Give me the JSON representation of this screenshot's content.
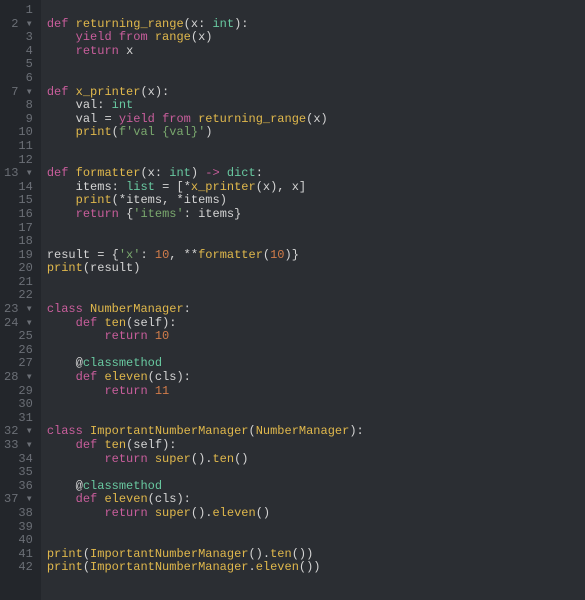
{
  "code": {
    "lines": [
      {
        "n": 1,
        "fold": false,
        "tokens": []
      },
      {
        "n": 2,
        "fold": true,
        "tokens": [
          {
            "c": "kw",
            "t": "def "
          },
          {
            "c": "fn",
            "t": "returning_range"
          },
          {
            "c": "op",
            "t": "("
          },
          {
            "c": "id",
            "t": "x"
          },
          {
            "c": "op",
            "t": ": "
          },
          {
            "c": "type",
            "t": "int"
          },
          {
            "c": "op",
            "t": "):"
          }
        ]
      },
      {
        "n": 3,
        "fold": false,
        "tokens": [
          {
            "c": "white",
            "t": "    "
          },
          {
            "c": "kw",
            "t": "yield from "
          },
          {
            "c": "bi",
            "t": "range"
          },
          {
            "c": "op",
            "t": "("
          },
          {
            "c": "id",
            "t": "x"
          },
          {
            "c": "op",
            "t": ")"
          }
        ]
      },
      {
        "n": 4,
        "fold": false,
        "tokens": [
          {
            "c": "white",
            "t": "    "
          },
          {
            "c": "kw",
            "t": "return "
          },
          {
            "c": "id",
            "t": "x"
          }
        ]
      },
      {
        "n": 5,
        "fold": false,
        "tokens": []
      },
      {
        "n": 6,
        "fold": false,
        "tokens": []
      },
      {
        "n": 7,
        "fold": true,
        "tokens": [
          {
            "c": "kw",
            "t": "def "
          },
          {
            "c": "fn",
            "t": "x_printer"
          },
          {
            "c": "op",
            "t": "("
          },
          {
            "c": "id",
            "t": "x"
          },
          {
            "c": "op",
            "t": "):"
          }
        ]
      },
      {
        "n": 8,
        "fold": false,
        "tokens": [
          {
            "c": "white",
            "t": "    "
          },
          {
            "c": "id",
            "t": "val"
          },
          {
            "c": "op",
            "t": ": "
          },
          {
            "c": "type",
            "t": "int"
          }
        ]
      },
      {
        "n": 9,
        "fold": false,
        "tokens": [
          {
            "c": "white",
            "t": "    "
          },
          {
            "c": "id",
            "t": "val"
          },
          {
            "c": "op",
            "t": " = "
          },
          {
            "c": "kw",
            "t": "yield from "
          },
          {
            "c": "fn",
            "t": "returning_range"
          },
          {
            "c": "op",
            "t": "("
          },
          {
            "c": "id",
            "t": "x"
          },
          {
            "c": "op",
            "t": ")"
          }
        ]
      },
      {
        "n": 10,
        "fold": false,
        "tokens": [
          {
            "c": "white",
            "t": "    "
          },
          {
            "c": "bi",
            "t": "print"
          },
          {
            "c": "op",
            "t": "("
          },
          {
            "c": "str",
            "t": "f'val {val}'"
          },
          {
            "c": "op",
            "t": ")"
          }
        ]
      },
      {
        "n": 11,
        "fold": false,
        "tokens": []
      },
      {
        "n": 12,
        "fold": false,
        "tokens": []
      },
      {
        "n": 13,
        "fold": true,
        "tokens": [
          {
            "c": "kw",
            "t": "def "
          },
          {
            "c": "fn",
            "t": "formatter"
          },
          {
            "c": "op",
            "t": "("
          },
          {
            "c": "id",
            "t": "x"
          },
          {
            "c": "op",
            "t": ": "
          },
          {
            "c": "type",
            "t": "int"
          },
          {
            "c": "op",
            "t": ") "
          },
          {
            "c": "arrow",
            "t": "-> "
          },
          {
            "c": "type",
            "t": "dict"
          },
          {
            "c": "op",
            "t": ":"
          }
        ]
      },
      {
        "n": 14,
        "fold": false,
        "tokens": [
          {
            "c": "white",
            "t": "    "
          },
          {
            "c": "id",
            "t": "items"
          },
          {
            "c": "op",
            "t": ": "
          },
          {
            "c": "type",
            "t": "list"
          },
          {
            "c": "op",
            "t": " = ["
          },
          {
            "c": "op",
            "t": "*"
          },
          {
            "c": "fn",
            "t": "x_printer"
          },
          {
            "c": "op",
            "t": "("
          },
          {
            "c": "id",
            "t": "x"
          },
          {
            "c": "op",
            "t": "), "
          },
          {
            "c": "id",
            "t": "x"
          },
          {
            "c": "op",
            "t": "]"
          }
        ]
      },
      {
        "n": 15,
        "fold": false,
        "tokens": [
          {
            "c": "white",
            "t": "    "
          },
          {
            "c": "bi",
            "t": "print"
          },
          {
            "c": "op",
            "t": "("
          },
          {
            "c": "op",
            "t": "*"
          },
          {
            "c": "id",
            "t": "items"
          },
          {
            "c": "op",
            "t": ", "
          },
          {
            "c": "op",
            "t": "*"
          },
          {
            "c": "id",
            "t": "items"
          },
          {
            "c": "op",
            "t": ")"
          }
        ]
      },
      {
        "n": 16,
        "fold": false,
        "tokens": [
          {
            "c": "white",
            "t": "    "
          },
          {
            "c": "kw",
            "t": "return "
          },
          {
            "c": "op",
            "t": "{"
          },
          {
            "c": "str",
            "t": "'items'"
          },
          {
            "c": "op",
            "t": ": "
          },
          {
            "c": "id",
            "t": "items"
          },
          {
            "c": "op",
            "t": "}"
          }
        ]
      },
      {
        "n": 17,
        "fold": false,
        "tokens": []
      },
      {
        "n": 18,
        "fold": false,
        "tokens": []
      },
      {
        "n": 19,
        "fold": false,
        "tokens": [
          {
            "c": "id",
            "t": "result"
          },
          {
            "c": "op",
            "t": " = {"
          },
          {
            "c": "str",
            "t": "'x'"
          },
          {
            "c": "op",
            "t": ": "
          },
          {
            "c": "num",
            "t": "10"
          },
          {
            "c": "op",
            "t": ", **"
          },
          {
            "c": "fn",
            "t": "formatter"
          },
          {
            "c": "op",
            "t": "("
          },
          {
            "c": "num",
            "t": "10"
          },
          {
            "c": "op",
            "t": ")}"
          }
        ]
      },
      {
        "n": 20,
        "fold": false,
        "tokens": [
          {
            "c": "bi",
            "t": "print"
          },
          {
            "c": "op",
            "t": "("
          },
          {
            "c": "id",
            "t": "result"
          },
          {
            "c": "op",
            "t": ")"
          }
        ]
      },
      {
        "n": 21,
        "fold": false,
        "tokens": []
      },
      {
        "n": 22,
        "fold": false,
        "tokens": []
      },
      {
        "n": 23,
        "fold": true,
        "tokens": [
          {
            "c": "kw",
            "t": "class "
          },
          {
            "c": "fn",
            "t": "NumberManager"
          },
          {
            "c": "op",
            "t": ":"
          }
        ]
      },
      {
        "n": 24,
        "fold": true,
        "tokens": [
          {
            "c": "white",
            "t": "    "
          },
          {
            "c": "kw",
            "t": "def "
          },
          {
            "c": "fn",
            "t": "ten"
          },
          {
            "c": "op",
            "t": "("
          },
          {
            "c": "self",
            "t": "self"
          },
          {
            "c": "op",
            "t": "):"
          }
        ]
      },
      {
        "n": 25,
        "fold": false,
        "tokens": [
          {
            "c": "white",
            "t": "        "
          },
          {
            "c": "kw",
            "t": "return "
          },
          {
            "c": "num",
            "t": "10"
          }
        ]
      },
      {
        "n": 26,
        "fold": false,
        "tokens": []
      },
      {
        "n": 27,
        "fold": false,
        "tokens": [
          {
            "c": "white",
            "t": "    "
          },
          {
            "c": "op",
            "t": "@"
          },
          {
            "c": "deco",
            "t": "classmethod"
          }
        ]
      },
      {
        "n": 28,
        "fold": true,
        "tokens": [
          {
            "c": "white",
            "t": "    "
          },
          {
            "c": "kw",
            "t": "def "
          },
          {
            "c": "fn",
            "t": "eleven"
          },
          {
            "c": "op",
            "t": "("
          },
          {
            "c": "self",
            "t": "cls"
          },
          {
            "c": "op",
            "t": "):"
          }
        ]
      },
      {
        "n": 29,
        "fold": false,
        "tokens": [
          {
            "c": "white",
            "t": "        "
          },
          {
            "c": "kw",
            "t": "return "
          },
          {
            "c": "num",
            "t": "11"
          }
        ]
      },
      {
        "n": 30,
        "fold": false,
        "tokens": []
      },
      {
        "n": 31,
        "fold": false,
        "tokens": []
      },
      {
        "n": 32,
        "fold": true,
        "tokens": [
          {
            "c": "kw",
            "t": "class "
          },
          {
            "c": "fn",
            "t": "ImportantNumberManager"
          },
          {
            "c": "op",
            "t": "("
          },
          {
            "c": "fn",
            "t": "NumberManager"
          },
          {
            "c": "op",
            "t": "):"
          }
        ]
      },
      {
        "n": 33,
        "fold": true,
        "tokens": [
          {
            "c": "white",
            "t": "    "
          },
          {
            "c": "kw",
            "t": "def "
          },
          {
            "c": "fn",
            "t": "ten"
          },
          {
            "c": "op",
            "t": "("
          },
          {
            "c": "self",
            "t": "self"
          },
          {
            "c": "op",
            "t": "):"
          }
        ]
      },
      {
        "n": 34,
        "fold": false,
        "tokens": [
          {
            "c": "white",
            "t": "        "
          },
          {
            "c": "kw",
            "t": "return "
          },
          {
            "c": "bi",
            "t": "super"
          },
          {
            "c": "op",
            "t": "()."
          },
          {
            "c": "fn",
            "t": "ten"
          },
          {
            "c": "op",
            "t": "()"
          }
        ]
      },
      {
        "n": 35,
        "fold": false,
        "tokens": []
      },
      {
        "n": 36,
        "fold": false,
        "tokens": [
          {
            "c": "white",
            "t": "    "
          },
          {
            "c": "op",
            "t": "@"
          },
          {
            "c": "deco",
            "t": "classmethod"
          }
        ]
      },
      {
        "n": 37,
        "fold": true,
        "tokens": [
          {
            "c": "white",
            "t": "    "
          },
          {
            "c": "kw",
            "t": "def "
          },
          {
            "c": "fn",
            "t": "eleven"
          },
          {
            "c": "op",
            "t": "("
          },
          {
            "c": "self",
            "t": "cls"
          },
          {
            "c": "op",
            "t": "):"
          }
        ]
      },
      {
        "n": 38,
        "fold": false,
        "tokens": [
          {
            "c": "white",
            "t": "        "
          },
          {
            "c": "kw",
            "t": "return "
          },
          {
            "c": "bi",
            "t": "super"
          },
          {
            "c": "op",
            "t": "()."
          },
          {
            "c": "fn",
            "t": "eleven"
          },
          {
            "c": "op",
            "t": "()"
          }
        ]
      },
      {
        "n": 39,
        "fold": false,
        "tokens": []
      },
      {
        "n": 40,
        "fold": false,
        "tokens": []
      },
      {
        "n": 41,
        "fold": false,
        "tokens": [
          {
            "c": "bi",
            "t": "print"
          },
          {
            "c": "op",
            "t": "("
          },
          {
            "c": "fn",
            "t": "ImportantNumberManager"
          },
          {
            "c": "op",
            "t": "()."
          },
          {
            "c": "fn",
            "t": "ten"
          },
          {
            "c": "op",
            "t": "())"
          }
        ]
      },
      {
        "n": 42,
        "fold": false,
        "tokens": [
          {
            "c": "bi",
            "t": "print"
          },
          {
            "c": "op",
            "t": "("
          },
          {
            "c": "fn",
            "t": "ImportantNumberManager"
          },
          {
            "c": "op",
            "t": "."
          },
          {
            "c": "fn",
            "t": "eleven"
          },
          {
            "c": "op",
            "t": "())"
          }
        ]
      }
    ]
  },
  "fold_marker": "▾"
}
